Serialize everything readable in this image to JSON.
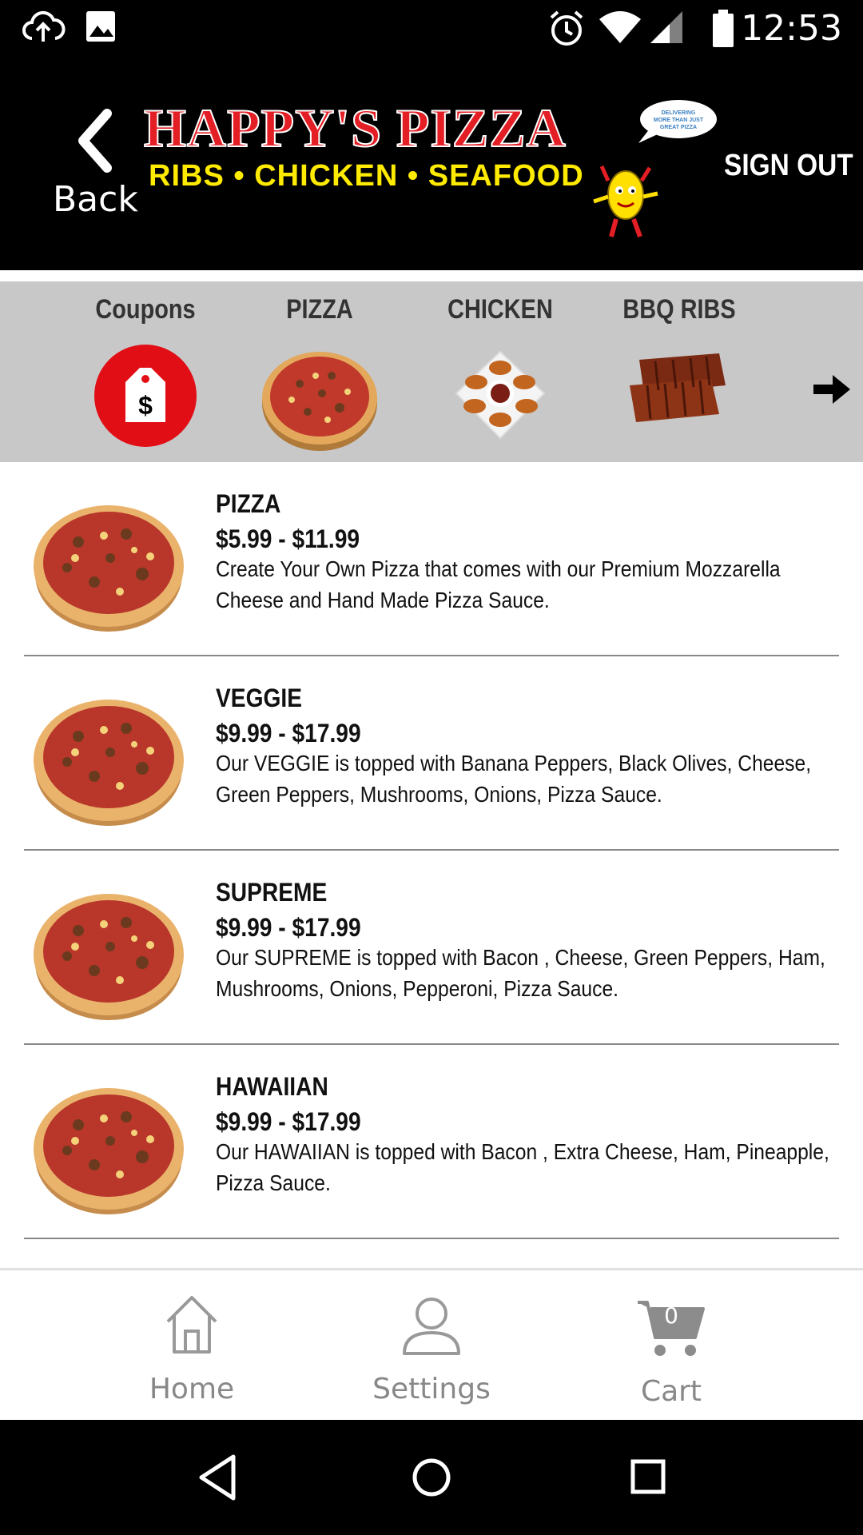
{
  "status_bar": {
    "time": "12:53"
  },
  "header": {
    "back_label": "Back",
    "logo_line1": "HAPPY'S PIZZA",
    "logo_line2": "RIBS • CHICKEN • SEAFOOD",
    "bubble_text": "DELIVERING MORE THAN JUST GREAT PIZZA",
    "signout_label": "SIGN OUT"
  },
  "categories": [
    {
      "label": "Coupons",
      "icon": "coupon-tag-icon"
    },
    {
      "label": "PIZZA",
      "icon": "pizza-image"
    },
    {
      "label": "CHICKEN",
      "icon": "chicken-wings-image"
    },
    {
      "label": "BBQ RIBS",
      "icon": "ribs-image"
    }
  ],
  "menu_items": [
    {
      "name": "PIZZA",
      "price": "$5.99 - $11.99",
      "description": "Create Your Own Pizza that comes with our Premium Mozzarella Cheese and Hand Made Pizza Sauce."
    },
    {
      "name": "VEGGIE",
      "price": "$9.99 - $17.99",
      "description": "Our VEGGIE is topped with Banana Peppers, Black Olives, Cheese, Green Peppers, Mushrooms, Onions, Pizza Sauce."
    },
    {
      "name": "SUPREME",
      "price": "$9.99 - $17.99",
      "description": "Our SUPREME is topped with Bacon , Cheese, Green Peppers, Ham, Mushrooms, Onions, Pepperoni, Pizza Sauce."
    },
    {
      "name": "HAWAIIAN",
      "price": "$9.99 - $17.99",
      "description": "Our HAWAIIAN is topped with Bacon , Extra Cheese, Ham, Pineapple, Pizza Sauce."
    }
  ],
  "tabs": [
    {
      "label": "Home",
      "icon": "home-icon"
    },
    {
      "label": "Settings",
      "icon": "person-icon"
    },
    {
      "label": "Cart",
      "icon": "cart-icon",
      "count": "0"
    }
  ],
  "colors": {
    "brand_red": "#e31e24",
    "brand_yellow": "#ffeb00",
    "category_bg": "#c8c8c8"
  }
}
